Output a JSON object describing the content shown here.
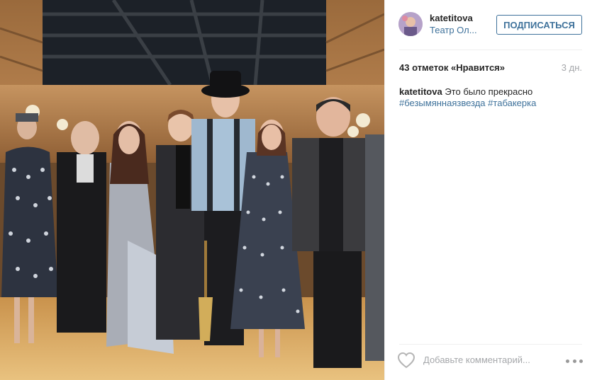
{
  "post": {
    "username": "katetitova",
    "location": "Театр Ол...",
    "follow_label": "ПОДПИСАТЬСЯ",
    "likes_count": "43 отметок «Нравится»",
    "time_ago": "3 дн.",
    "caption": {
      "username": "katetitova",
      "text": "Это было прекрасно",
      "hashtags": [
        "#безымяннаязвезда",
        "#табакерка"
      ]
    },
    "comment_placeholder": "Добавьте комментарий..."
  },
  "icons": {
    "like": "heart-icon",
    "more": "more-options-icon"
  },
  "colors": {
    "link": "#3f729b",
    "muted": "#a5a7aa",
    "text": "#262626"
  }
}
